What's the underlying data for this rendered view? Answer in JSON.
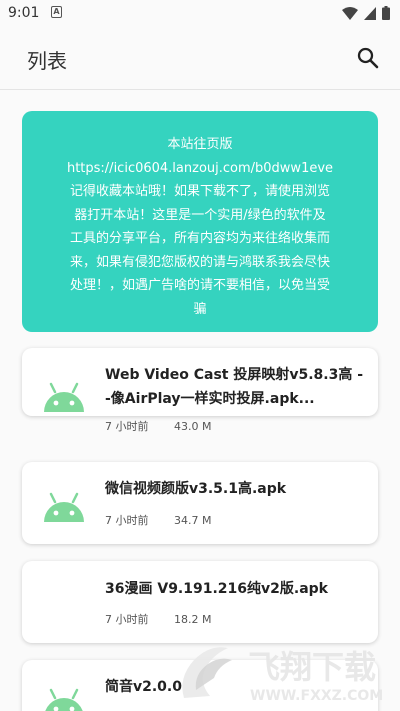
{
  "status_bar": {
    "time": "9:01",
    "notification_icon": "A",
    "icons": [
      "wifi-icon",
      "signal-icon",
      "battery-icon"
    ]
  },
  "app_bar": {
    "title": "列表",
    "search_icon": "search-icon"
  },
  "notice": {
    "lines": [
      "本站往页版",
      "https://icic0604.lanzouj.com/b0dww1eve",
      "记得收藏本站哦！如果下载不了，请使用浏览",
      "器打开本站！这里是一个实用/绿色的软件及",
      "工具的分享平台，所有内容均为来往络收集而",
      "来，如果有侵犯您版权的请与鸿联系我会尽快",
      "处理！，如遇广告啥的请不要相信，以免当受",
      "骗"
    ],
    "background": "#35d3bf"
  },
  "files": [
    {
      "name": "Web Video Cast 投屏映射v5.8.3高 --像AirPlay一样实时投屏.apk...",
      "time": "7 小时前",
      "size": "43.0 M",
      "icon": "android-icon"
    },
    {
      "name": "微信视频颜版v3.5.1高.apk",
      "time": "7 小时前",
      "size": "34.7 M",
      "icon": "android-icon"
    },
    {
      "name": "36漫画 V9.191.216纯v2版.apk",
      "time": "7 小时前",
      "size": "18.2 M",
      "icon": "android-icon"
    },
    {
      "name": "简音v2.0.0",
      "time": "",
      "size": "",
      "icon": "android-icon"
    }
  ],
  "watermark": {
    "brand": "飞翔下载",
    "url": "WWW.FXXZ.COM"
  },
  "colors": {
    "accent": "#35d3bf",
    "android_green": "#7fd89a"
  }
}
